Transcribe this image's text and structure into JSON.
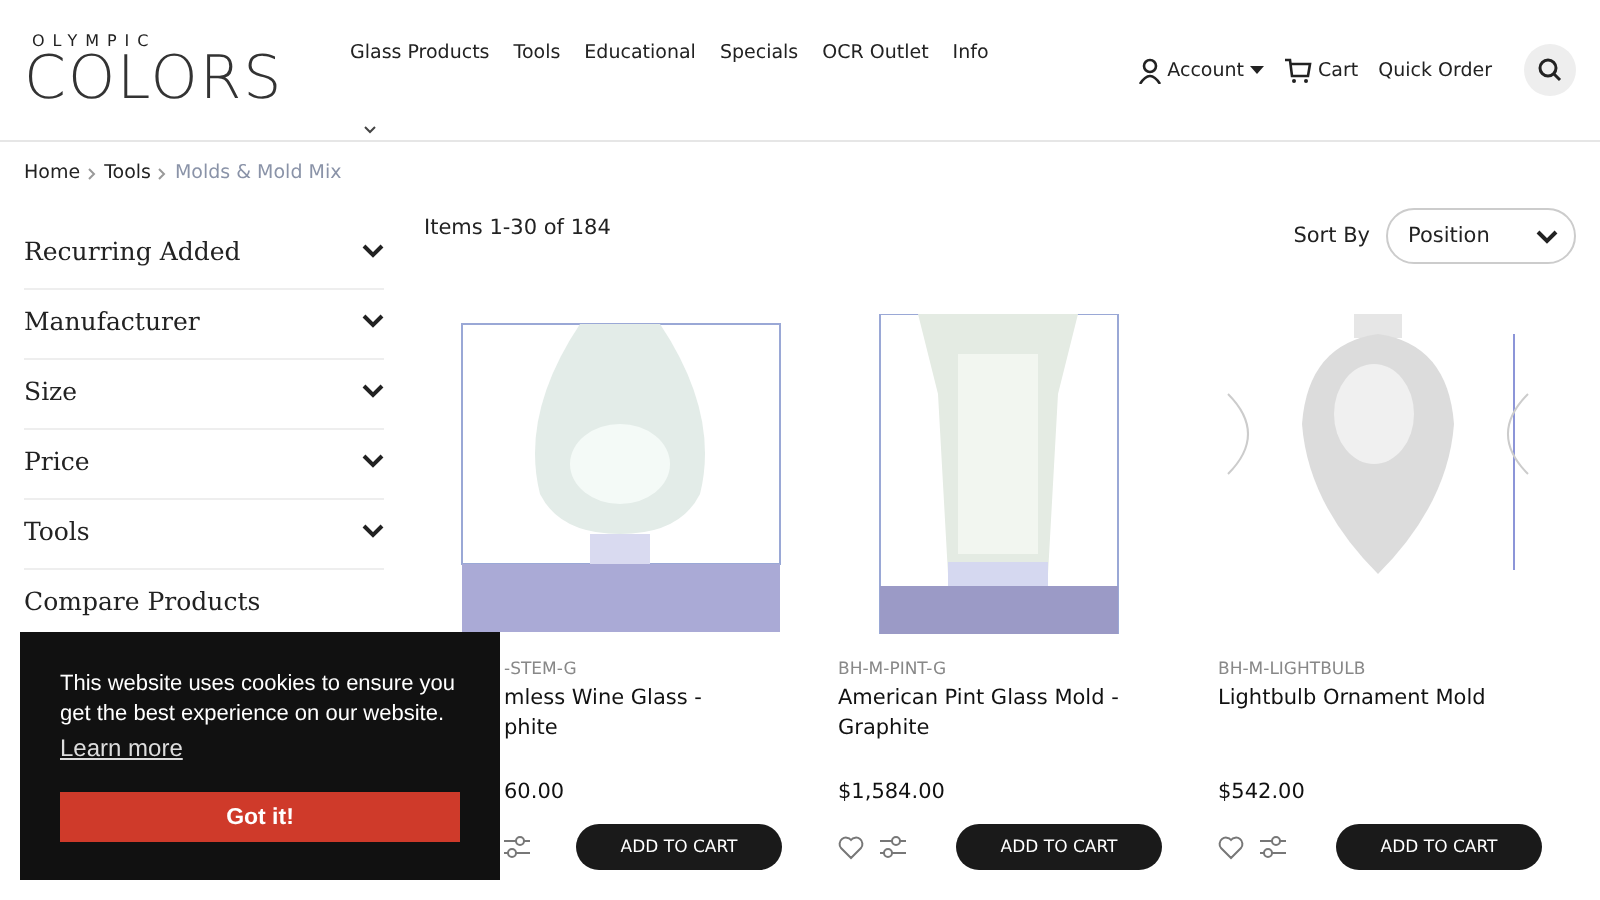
{
  "brand": {
    "small": "OLYMPIC",
    "large": "COLORS"
  },
  "nav": [
    "Glass Products",
    "Tools",
    "Educational",
    "Specials",
    "OCR Outlet",
    "Info"
  ],
  "header_links": {
    "account": "Account",
    "cart": "Cart",
    "quick_order": "Quick Order"
  },
  "breadcrumb": [
    {
      "label": "Home",
      "current": false
    },
    {
      "label": "Tools",
      "current": false
    },
    {
      "label": "Molds & Mold Mix",
      "current": true
    }
  ],
  "filters": [
    {
      "label": "Recurring Added",
      "expanded": false
    },
    {
      "label": "Manufacturer",
      "expanded": false
    },
    {
      "label": "Size",
      "expanded": false
    },
    {
      "label": "Price",
      "expanded": false
    },
    {
      "label": "Tools",
      "expanded": false
    }
  ],
  "compare_title": "Compare Products",
  "toolbar": {
    "count": "Items 1-30 of 184",
    "sort_label": "Sort By",
    "sort_value": "Position"
  },
  "products": [
    {
      "kind": "picture",
      "covered": true,
      "sku": "-STEM-G",
      "name": "mless Wine Glass -",
      "name_2": "phite",
      "price": "60.00",
      "button": "ADD TO CART"
    },
    {
      "kind": "picture",
      "covered": false,
      "sku": "BH-M-PINT-G",
      "name": "American Pint Glass Mold -",
      "name_2": "Graphite",
      "price": "$1,584.00",
      "button": "ADD TO CART"
    },
    {
      "kind": "picture",
      "covered": false,
      "sku": "BH-M-LIGHTBULB",
      "name": "Lightbulb Ornament Mold",
      "price": "$542.00",
      "button": "ADD TO CART"
    }
  ],
  "cookie": {
    "message": "This website uses cookies to ensure you get the best experience on our website.",
    "link": "Learn more",
    "button": "Got it!"
  }
}
